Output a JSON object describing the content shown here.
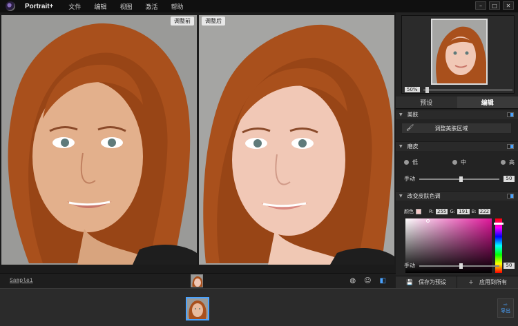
{
  "app": {
    "title": "Portrait+"
  },
  "menu": [
    "文件",
    "编辑",
    "视图",
    "激活",
    "帮助"
  ],
  "window_controls": {
    "minimize": "–",
    "maximize": "□",
    "close": "✕"
  },
  "panes": {
    "before_label": "调整前",
    "after_label": "调整后"
  },
  "navigator": {
    "zoom": "50%"
  },
  "tabs": [
    {
      "label": "预设",
      "active": false
    },
    {
      "label": "编辑",
      "active": true
    }
  ],
  "sections": {
    "beauty": {
      "title": "美肤",
      "button_label": "调整美肤区域"
    },
    "smoothing": {
      "title": "磨皮",
      "options": [
        "低",
        "中",
        "高"
      ],
      "manual_label": "手动",
      "manual_value": "50"
    },
    "skin_tone": {
      "title": "改变皮肤色调",
      "color_label": "颜色",
      "r_label": "R:",
      "r_value": "255",
      "g_label": "G:",
      "g_value": "191",
      "b_label": "B:",
      "b_value": "222",
      "manual_label": "手动",
      "manual_value": "50",
      "swatch_color": "#f6c8c8"
    }
  },
  "actions": {
    "save_preset": "保存为预设",
    "apply_all": "应用到所有"
  },
  "status": {
    "sample_name": "Sample1"
  },
  "export": {
    "label": "导出"
  },
  "colors": {
    "accent": "#4aa3ff",
    "panel": "#232323",
    "hair": "#b0531f"
  }
}
